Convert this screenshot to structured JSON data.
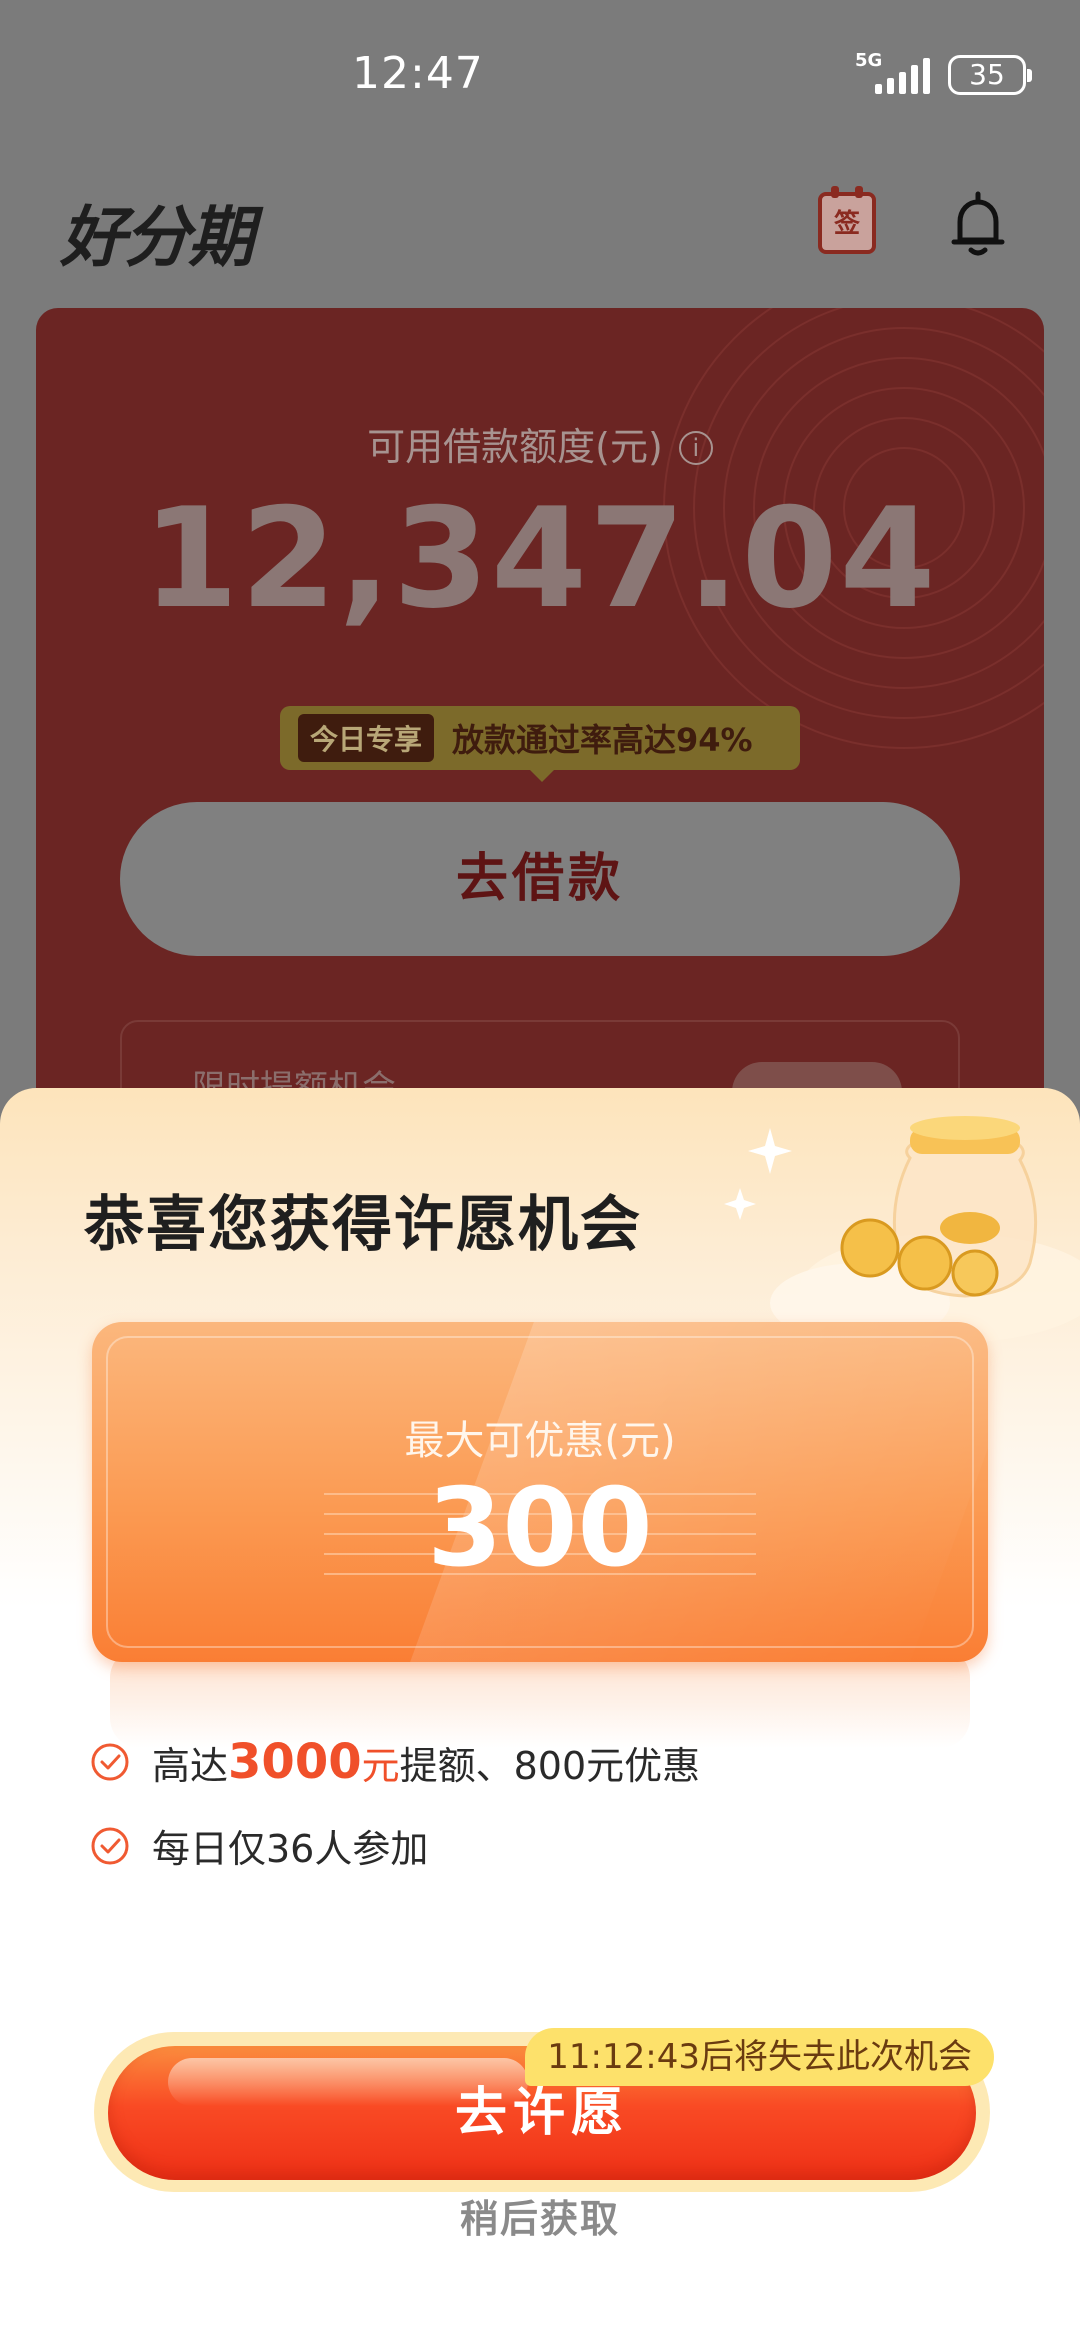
{
  "status_bar": {
    "time": "12:47",
    "network": "5G",
    "battery": "35"
  },
  "header": {
    "logo": "好分期",
    "checkin_label": "签"
  },
  "credit_card": {
    "label": "可用借款额度(元)",
    "info_glyph": "i",
    "amount": "12,347.04",
    "promo_badge": "今日专享",
    "promo_text": "放款通过率高达94%",
    "borrow_button": "去借款",
    "limit_hint": "限时提额机会"
  },
  "sheet": {
    "title": "恭喜您获得许愿机会",
    "offer_label": "最大可优惠(元)",
    "offer_value": "300",
    "benefit_1_prefix": "高达",
    "benefit_1_highlight": "3000",
    "benefit_1_unit": "元",
    "benefit_1_suffix": "提额、800元优惠",
    "benefit_2": "每日仅36人参加",
    "countdown": "11:12:43后将失去此次机会",
    "wish_button": "去许愿",
    "later_link": "稍后获取"
  },
  "colors": {
    "overlay_gray": "#7b7b7b",
    "card_red_dimmed": "#6b2523",
    "accent_orange": "#fa7e34",
    "cta_red": "#f94a24",
    "countdown_yellow": "#fde16b",
    "highlight_red": "#f0502a"
  }
}
